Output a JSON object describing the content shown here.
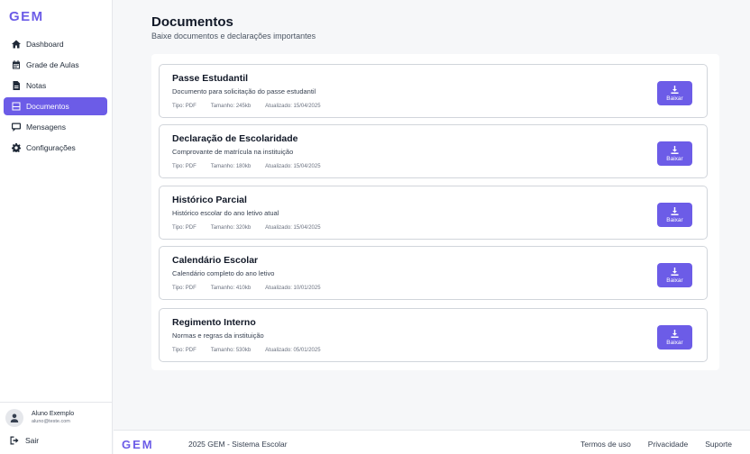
{
  "brand": {
    "logo": "GEM",
    "accent": "#6c5ce7"
  },
  "sidebar": {
    "items": [
      {
        "label": "Dashboard",
        "icon": "home-icon"
      },
      {
        "label": "Grade de Aulas",
        "icon": "calendar-icon"
      },
      {
        "label": "Notas",
        "icon": "file-icon"
      },
      {
        "label": "Documentos",
        "icon": "document-icon",
        "active": true
      },
      {
        "label": "Mensagens",
        "icon": "message-icon"
      },
      {
        "label": "Configurações",
        "icon": "gear-icon"
      }
    ],
    "user": {
      "name": "Aluno Exemplo",
      "email": "aluno@teste.com"
    },
    "logout_label": "Sair"
  },
  "main": {
    "title": "Documentos",
    "subtitle": "Baixe documentos e declarações importantes",
    "documents": [
      {
        "title": "Passe Estudantil",
        "description": "Documento para solicitação do passe estudantil",
        "type": "Tipo: PDF",
        "size": "Tamanho: 245kb",
        "updated": "Atualizado: 15/04/2025",
        "button_label": "Baixar"
      },
      {
        "title": "Declaração de Escolaridade",
        "description": "Comprovante de matrícula na instituição",
        "type": "Tipo: PDF",
        "size": "Tamanho: 180kb",
        "updated": "Atualizado: 15/04/2025",
        "button_label": "Baixar"
      },
      {
        "title": "Histórico Parcial",
        "description": "Histórico escolar do ano letivo atual",
        "type": "Tipo: PDF",
        "size": "Tamanho: 320kb",
        "updated": "Atualizado: 15/04/2025",
        "button_label": "Baixar"
      },
      {
        "title": "Calendário Escolar",
        "description": "Calendário completo do ano letivo",
        "type": "Tipo: PDF",
        "size": "Tamanho: 410kb",
        "updated": "Atualizado: 10/01/2025",
        "button_label": "Baixar"
      },
      {
        "title": "Regimento Interno",
        "description": "Normas e regras da instituição",
        "type": "Tipo: PDF",
        "size": "Tamanho: 530kb",
        "updated": "Atualizado: 05/01/2025",
        "button_label": "Baixar"
      }
    ]
  },
  "footer": {
    "logo": "GEM",
    "copyright": "2025 GEM - Sistema Escolar",
    "links": [
      "Termos de uso",
      "Privacidade",
      "Suporte"
    ]
  }
}
